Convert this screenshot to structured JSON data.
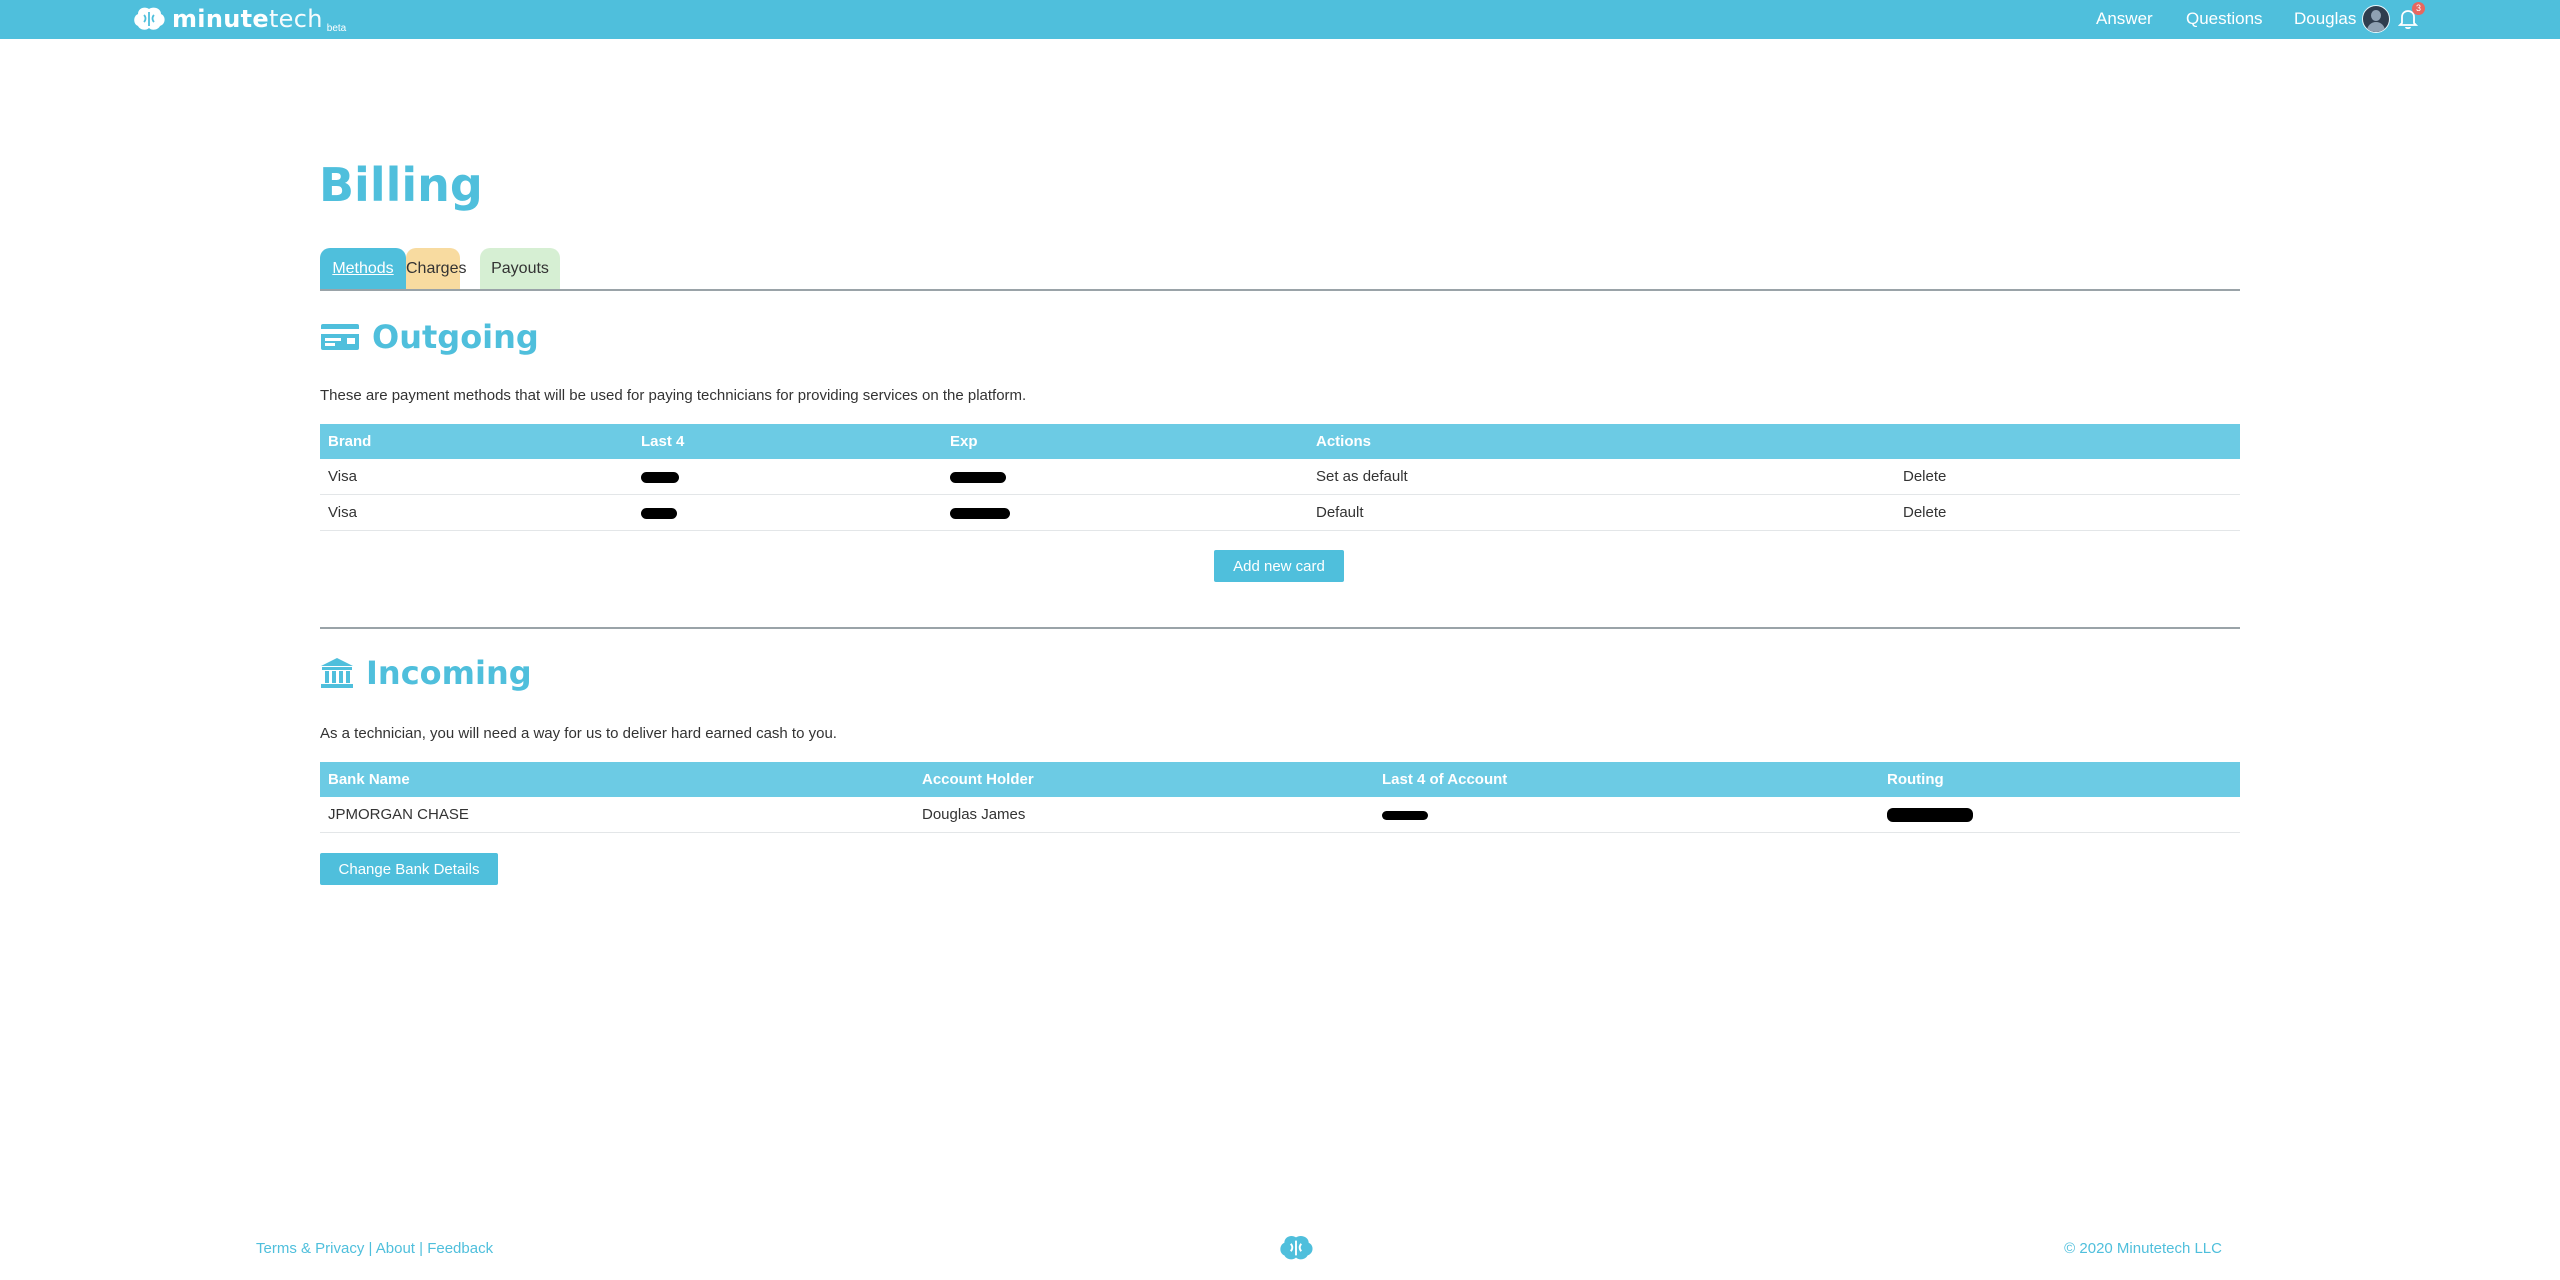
{
  "header": {
    "logo_bold": "minute",
    "logo_light": "tech",
    "logo_badge": "beta",
    "nav": [
      "Answer",
      "Questions",
      "Douglas"
    ],
    "notification_count": "3"
  },
  "page": {
    "title": "Billing"
  },
  "tabs": [
    "Methods",
    "Charges",
    "Payouts"
  ],
  "outgoing": {
    "title": "Outgoing",
    "description": "These are payment methods that will be used for paying technicians for providing services on the platform.",
    "columns": [
      "Brand",
      "Last 4",
      "Exp",
      "Actions"
    ],
    "rows": [
      {
        "brand": "Visa",
        "action": "Set as default",
        "delete": "Delete"
      },
      {
        "brand": "Visa",
        "action": "Default",
        "delete": "Delete"
      }
    ],
    "add_button": "Add new card"
  },
  "incoming": {
    "title": "Incoming",
    "description": "As a technician, you will need a way for us to deliver hard earned cash to you.",
    "columns": [
      "Bank Name",
      "Account Holder",
      "Last 4 of Account",
      "Routing"
    ],
    "rows": [
      {
        "bank": "JPMORGAN CHASE",
        "holder": "Douglas James"
      }
    ],
    "change_button": "Change Bank Details"
  },
  "footer": {
    "terms": "Terms & Privacy",
    "sep": " | ",
    "about": "About",
    "feedback": "Feedback",
    "copyright": "© 2020 Minutetech LLC"
  },
  "colors": {
    "accent": "#4fbfdc",
    "charges_tab": "#f8dba0",
    "payouts_tab": "#d6efd3",
    "delete": "#e0607e",
    "default": "#5fb38f"
  }
}
